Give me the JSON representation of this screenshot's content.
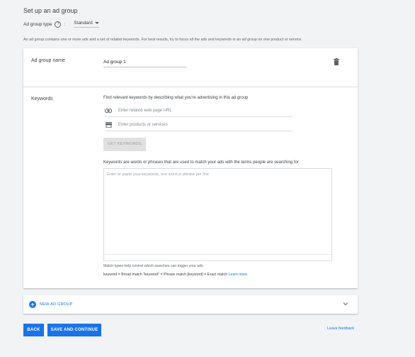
{
  "page": {
    "title": "Set up an ad group",
    "ad_group_type_label": "Ad group type",
    "ad_group_type_value": "Standard",
    "description": "An ad group contains one or more ads and a set of related keywords. For best results, try to focus all the ads and keywords in an ad group on one product or service."
  },
  "ad_group": {
    "name_label": "Ad group name",
    "name_value": "Ad group 1"
  },
  "keywords": {
    "label": "Keywords",
    "hint": "Find relevant keywords by describing what you're advertising in this ad group",
    "url_placeholder": "Enter related web page URL",
    "products_placeholder": "Enter products or services",
    "get_keywords_label": "GET KEYWORDS",
    "description": "Keywords are words or phrases that are used to match your ads with the terms people are searching for",
    "textarea_placeholder": "Enter or paste your keywords, one word or phrase per line",
    "match_help": "Match types help control which searches can trigger your ads",
    "match_examples": "keyword = Broad match  \"keyword\" = Phrase match  [keyword] = Exact match",
    "learn_more": "Learn more"
  },
  "new_ad_group": {
    "label": "NEW AD GROUP"
  },
  "footer": {
    "back_label": "BACK",
    "save_label": "SAVE AND CONTINUE",
    "feedback_label": "Leave feedback"
  },
  "colors": {
    "accent": "#1a73e8",
    "background": "#f1f3f4"
  },
  "icons": {
    "help": "help-icon",
    "dropdown": "caret-down-icon",
    "delete": "trash-icon",
    "link": "link-icon",
    "store": "store-icon",
    "add": "plus-icon",
    "expand": "chevron-down-icon"
  }
}
